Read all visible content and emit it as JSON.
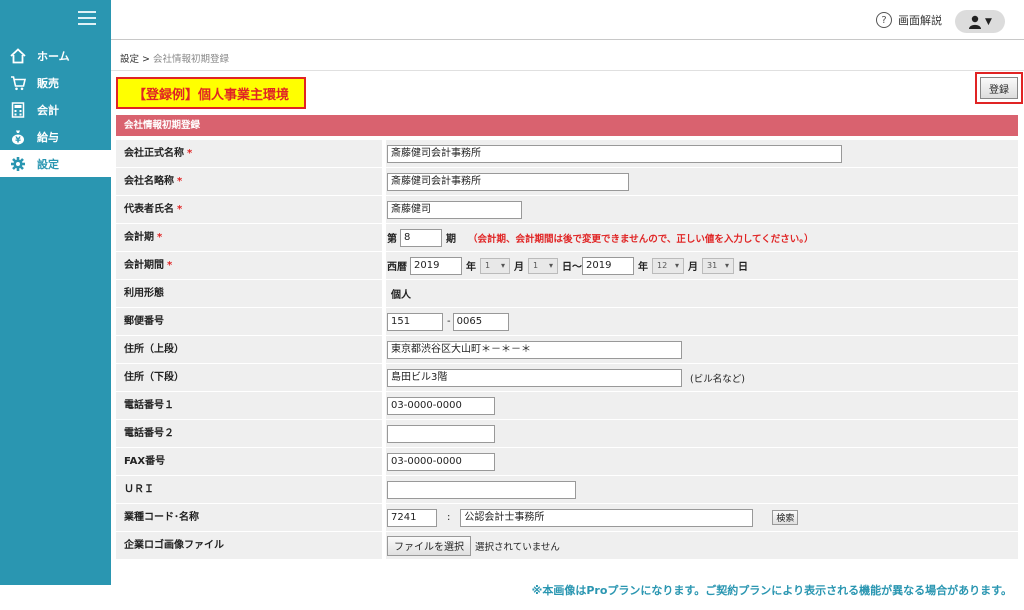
{
  "sidebar": {
    "items": [
      {
        "label": "ホーム",
        "icon": "home-icon"
      },
      {
        "label": "販売",
        "icon": "cart-icon"
      },
      {
        "label": "会計",
        "icon": "calculator-icon"
      },
      {
        "label": "給与",
        "icon": "money-bag-icon"
      },
      {
        "label": "設定",
        "icon": "gear-icon"
      }
    ],
    "active_index": 4
  },
  "header": {
    "help_icon": "?",
    "help_label": "画面解説",
    "user_menu_arrow": "▼"
  },
  "breadcrumb": {
    "parent": "設定",
    "separator": ">",
    "current": "会社情報初期登録"
  },
  "example_banner": "【登録例】個人事業主環境",
  "register_button": "登録",
  "section_title": "会社情報初期登録",
  "required_mark": "*",
  "form": {
    "official_name": {
      "label": "会社正式名称",
      "value": "斎藤健司会計事務所"
    },
    "short_name": {
      "label": "会社名略称",
      "value": "斎藤健司会計事務所"
    },
    "representative": {
      "label": "代表者氏名",
      "value": "斎藤健司"
    },
    "fiscal_term": {
      "label": "会計期",
      "prefix": "第",
      "value": "8",
      "suffix": "期",
      "note": "（会計期、会計期間は後で変更できませんので、正しい値を入力してください。）"
    },
    "fiscal_period": {
      "label": "会計期間",
      "era": "西暦",
      "start_year": "2019",
      "year_unit": "年",
      "start_month": "1",
      "month_unit": "月",
      "start_day": "1",
      "day_tilde": "日〜",
      "end_year": "2019",
      "end_month": "12",
      "end_day": "31",
      "day_unit": "日"
    },
    "business_type": {
      "label": "利用形態",
      "value": "個人"
    },
    "postal": {
      "label": "郵便番号",
      "first": "151",
      "dash": "-",
      "second": "0065"
    },
    "address1": {
      "label": "住所（上段）",
      "value": "東京都渋谷区大山町＊－＊－＊"
    },
    "address2": {
      "label": "住所（下段）",
      "value": "島田ビル3階",
      "hint": "(ビル名など)"
    },
    "phone1": {
      "label": "電話番号１",
      "value": "03-0000-0000"
    },
    "phone2": {
      "label": "電話番号２",
      "value": ""
    },
    "fax": {
      "label": "FAX番号",
      "value": "03-0000-0000"
    },
    "uri": {
      "label": "ＵＲＩ",
      "value": ""
    },
    "industry": {
      "label": "業種コード･名称",
      "code": "7241",
      "colon": ":",
      "name": "公認会計士事務所",
      "search_button": "検索"
    },
    "logo": {
      "label": "企業ロゴ画像ファイル",
      "file_button": "ファイルを選択",
      "status": "選択されていません"
    }
  },
  "footer_note": "※本画像はProプランになります。ご契約プランにより表示される機能が異なる場合があります。",
  "colors": {
    "sidebar": "#2a96b1",
    "section_header": "#d9626f",
    "highlight": "#ffff00",
    "alert": "#e02424"
  }
}
